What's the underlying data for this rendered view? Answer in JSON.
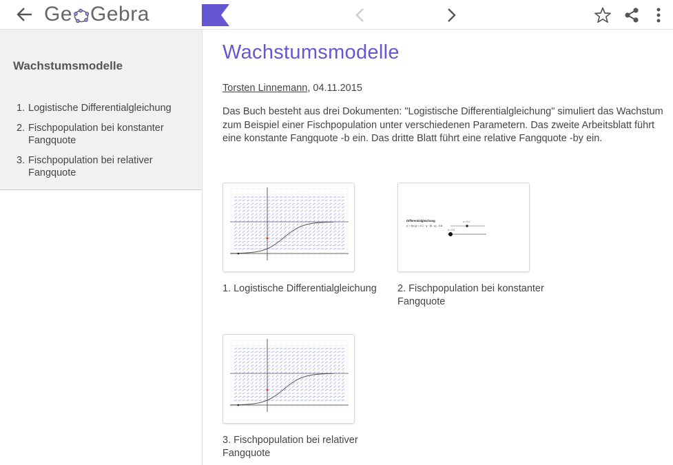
{
  "header": {
    "logo_text_before": "Ge",
    "logo_text_after": "Gebra",
    "accent_color": "#6557d2"
  },
  "sidebar": {
    "title": "Wachstumsmodelle",
    "items": [
      {
        "num": "1.",
        "label": "Logistische Differentialgleichung"
      },
      {
        "num": "2.",
        "label": "Fischpopulation bei konstanter Fangquote"
      },
      {
        "num": "3.",
        "label": "Fischpopulation bei relativer Fangquote"
      }
    ]
  },
  "main": {
    "title": "Wachstumsmodelle",
    "author": "Torsten Linnemann",
    "date": ", 04.11.2015",
    "description": "Das Buch besteht aus drei Dokumenten: \"Logistische Differentialgleichung\" simuliert das Wachstum zum Beispiel einer Fischpopulation unter verschiedenen Parametern. Das zweite Arbeitsblatt führt eine konstante Fangquote -b ein. Das dritte Blatt führt eine relative Fangquote -by ein.",
    "cards": [
      {
        "label": "1. Logistische Differentialgleichung",
        "thumb": "slope-field-graph"
      },
      {
        "label": "2. Fischpopulation bei konstanter Fangquote",
        "thumb": "slider-worksheet",
        "thumb_title": "Differentialgleichung",
        "thumb_formula": "y' = f(x,y) = 0.1 · y · (6 - y) - 0.8",
        "thumb_slider_a": "a = 0.4",
        "thumb_slider_b": "b = 0.8"
      },
      {
        "label": "3. Fischpopulation bei relativer Fangquote",
        "thumb": "slope-field-graph"
      }
    ]
  }
}
